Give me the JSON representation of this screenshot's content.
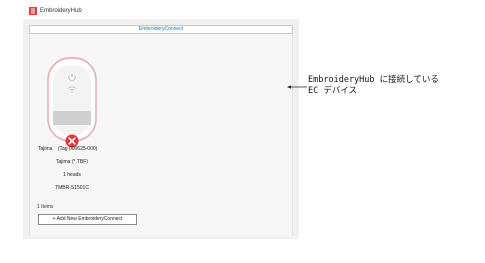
{
  "window": {
    "app_title": "EmbroideryHub",
    "app_icon": "embroidery-hub-logo-icon",
    "accent_color": "#e33b3b"
  },
  "tab": {
    "label": "EmbroideryConnect"
  },
  "device": {
    "icons": [
      "power-icon",
      "wifi-icon",
      "disconnected-error-icon"
    ],
    "status_color": "#d93a3a",
    "name": "Tajima",
    "tag": "(Tag 000625-000)",
    "format": "Tajima (*.TBF)",
    "heads": "1 heads",
    "model": "TMBR-S1501C"
  },
  "footer": {
    "items_count": "1 Items",
    "add_button_label": "+ Add New EmbroideryConnect"
  },
  "callout": {
    "line1": "EmbroideryHub に接続している",
    "line2": "EC デバイス"
  }
}
